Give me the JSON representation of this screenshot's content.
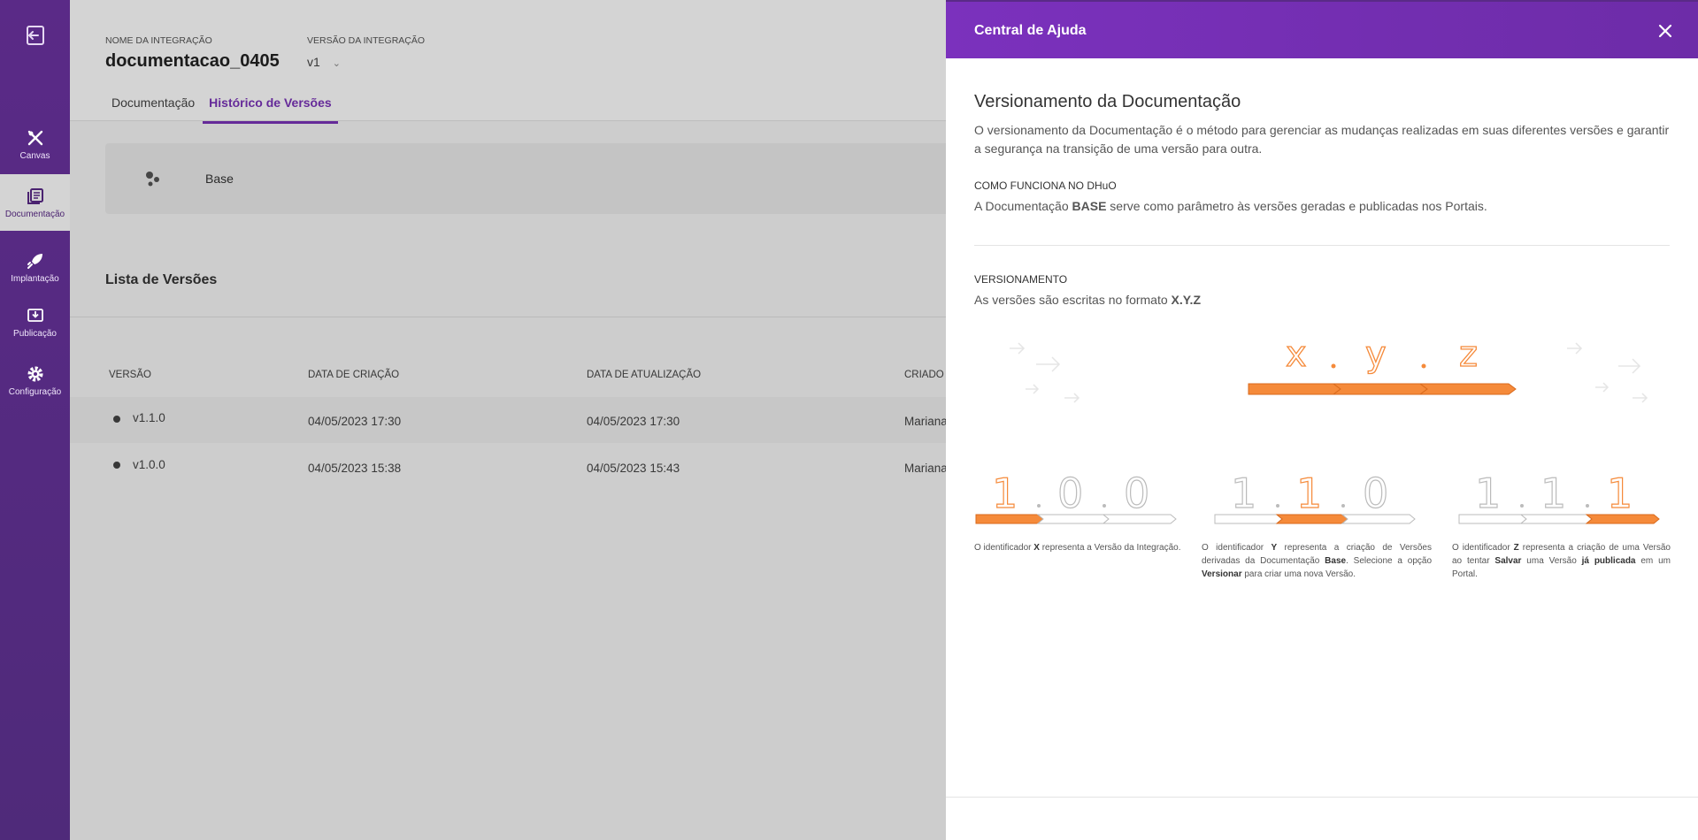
{
  "sidebar": {
    "items": [
      {
        "label": "Canvas",
        "icon": "canvas-icon"
      },
      {
        "label": "Documentação",
        "icon": "documentation-icon"
      },
      {
        "label": "Implantação",
        "icon": "rocket-icon"
      },
      {
        "label": "Publicação",
        "icon": "publish-icon"
      },
      {
        "label": "Configuração",
        "icon": "gear-icon"
      }
    ],
    "active_index": 1
  },
  "header": {
    "integration_label": "NOME DA INTEGRAÇÃO",
    "integration_name": "documentacao_0405",
    "version_label": "VERSÃO DA INTEGRAÇÃO",
    "version_value": "v1",
    "tabs": [
      {
        "label": "Documentação"
      },
      {
        "label": "Histórico de Versões"
      }
    ],
    "active_tab": 1
  },
  "base_card": {
    "label": "Base"
  },
  "versions_list": {
    "title": "Lista de Versões",
    "columns": [
      "VERSÃO",
      "DATA DE CRIAÇÃO",
      "DATA DE ATUALIZAÇÃO",
      "CRIADO"
    ],
    "rows": [
      {
        "version": "v1.1.0",
        "created": "04/05/2023 17:30",
        "updated": "04/05/2023 17:30",
        "author": "Mariana"
      },
      {
        "version": "v1.0.0",
        "created": "04/05/2023 15:38",
        "updated": "04/05/2023 15:43",
        "author": "Mariana"
      }
    ]
  },
  "help_panel": {
    "title": "Central de Ajuda",
    "heading": "Versionamento da Documentação",
    "intro_line1": "O versionamento da Documentação é o método para gerenciar as mudanças realizadas em suas diferentes versões e garantir",
    "intro_line2": "a segurança na transição de uma versão para outra.",
    "how_title": "COMO FUNCIONA NO DHuO",
    "how_text_pre": "A Documentação ",
    "how_text_bold": "BASE",
    "how_text_post": " serve como parâmetro às versões geradas e publicadas nos Portais.",
    "versioning_title": "VERSIONAMENTO",
    "versioning_text_pre": "As versões são escritas no formato ",
    "versioning_text_bold": "X.Y.Z",
    "diagram_letters": [
      "x",
      "y",
      "z"
    ],
    "examples": [
      {
        "digits": [
          "1",
          "0",
          "0"
        ],
        "highlight": 0,
        "caption_parts": [
          "O identificador ",
          "X",
          " representa a Versão da Integração."
        ]
      },
      {
        "digits": [
          "1",
          "1",
          "0"
        ],
        "highlight": 1,
        "caption_parts": [
          "O identificador ",
          "Y",
          " representa a criação de Versões derivadas da Documentação ",
          "Base",
          ". Selecione a opção ",
          "Versionar",
          " para criar uma nova Versão."
        ]
      },
      {
        "digits": [
          "1",
          "1",
          "1"
        ],
        "highlight": 2,
        "caption_parts": [
          "O identificador ",
          "Z",
          " representa a criação de uma Versão ao tentar ",
          "Salvar",
          " uma Versão ",
          "já publicada",
          " em um Portal."
        ]
      }
    ],
    "colors": {
      "accent": "#f58a3a",
      "purple": "#7a33b8"
    }
  }
}
